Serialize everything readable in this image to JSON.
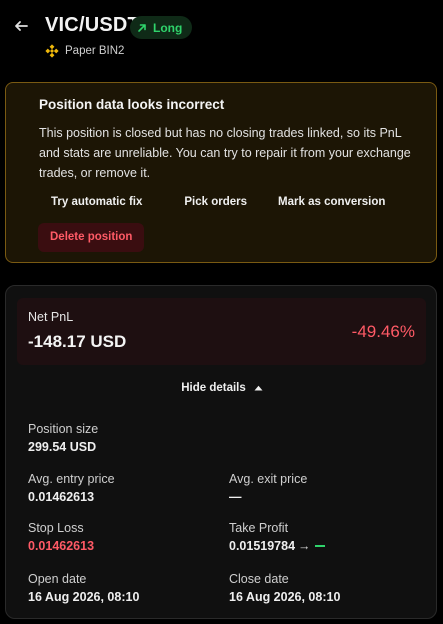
{
  "header": {
    "title": "VIC/USDT",
    "badge": "Long",
    "exchange": "Paper BIN2"
  },
  "warning": {
    "title": "Position data looks incorrect",
    "body": "This position is closed but has no closing trades linked, so its PnL and stats are unreliable. You can try to repair it from your exchange trades, or remove it.",
    "actions": [
      "Try automatic fix",
      "Pick orders",
      "Mark as conversion"
    ],
    "delete_label": "Delete position"
  },
  "pnl": {
    "label": "Net PnL",
    "value": "-148.17 USD",
    "percent": "-49.46%"
  },
  "details_toggle": "Hide details",
  "stats": {
    "position_size": {
      "label": "Position size",
      "value": "299.54 USD"
    },
    "avg_entry": {
      "label": "Avg. entry price",
      "value": "0.01462613"
    },
    "avg_exit": {
      "label": "Avg. exit price",
      "value": "—"
    },
    "stop_loss": {
      "label": "Stop Loss",
      "value": "0.01462613"
    },
    "take_profit": {
      "label": "Take Profit",
      "value": "0.01519784",
      "arrow": "→"
    },
    "open_date": {
      "label": "Open date",
      "value": "16 Aug 2026, 08:10"
    },
    "close_date": {
      "label": "Close date",
      "value": "16 Aug 2026, 08:10"
    }
  },
  "colors": {
    "accent_green": "#2fd36b",
    "danger_red": "#ff5a66",
    "warning_border": "#7a5a12"
  }
}
